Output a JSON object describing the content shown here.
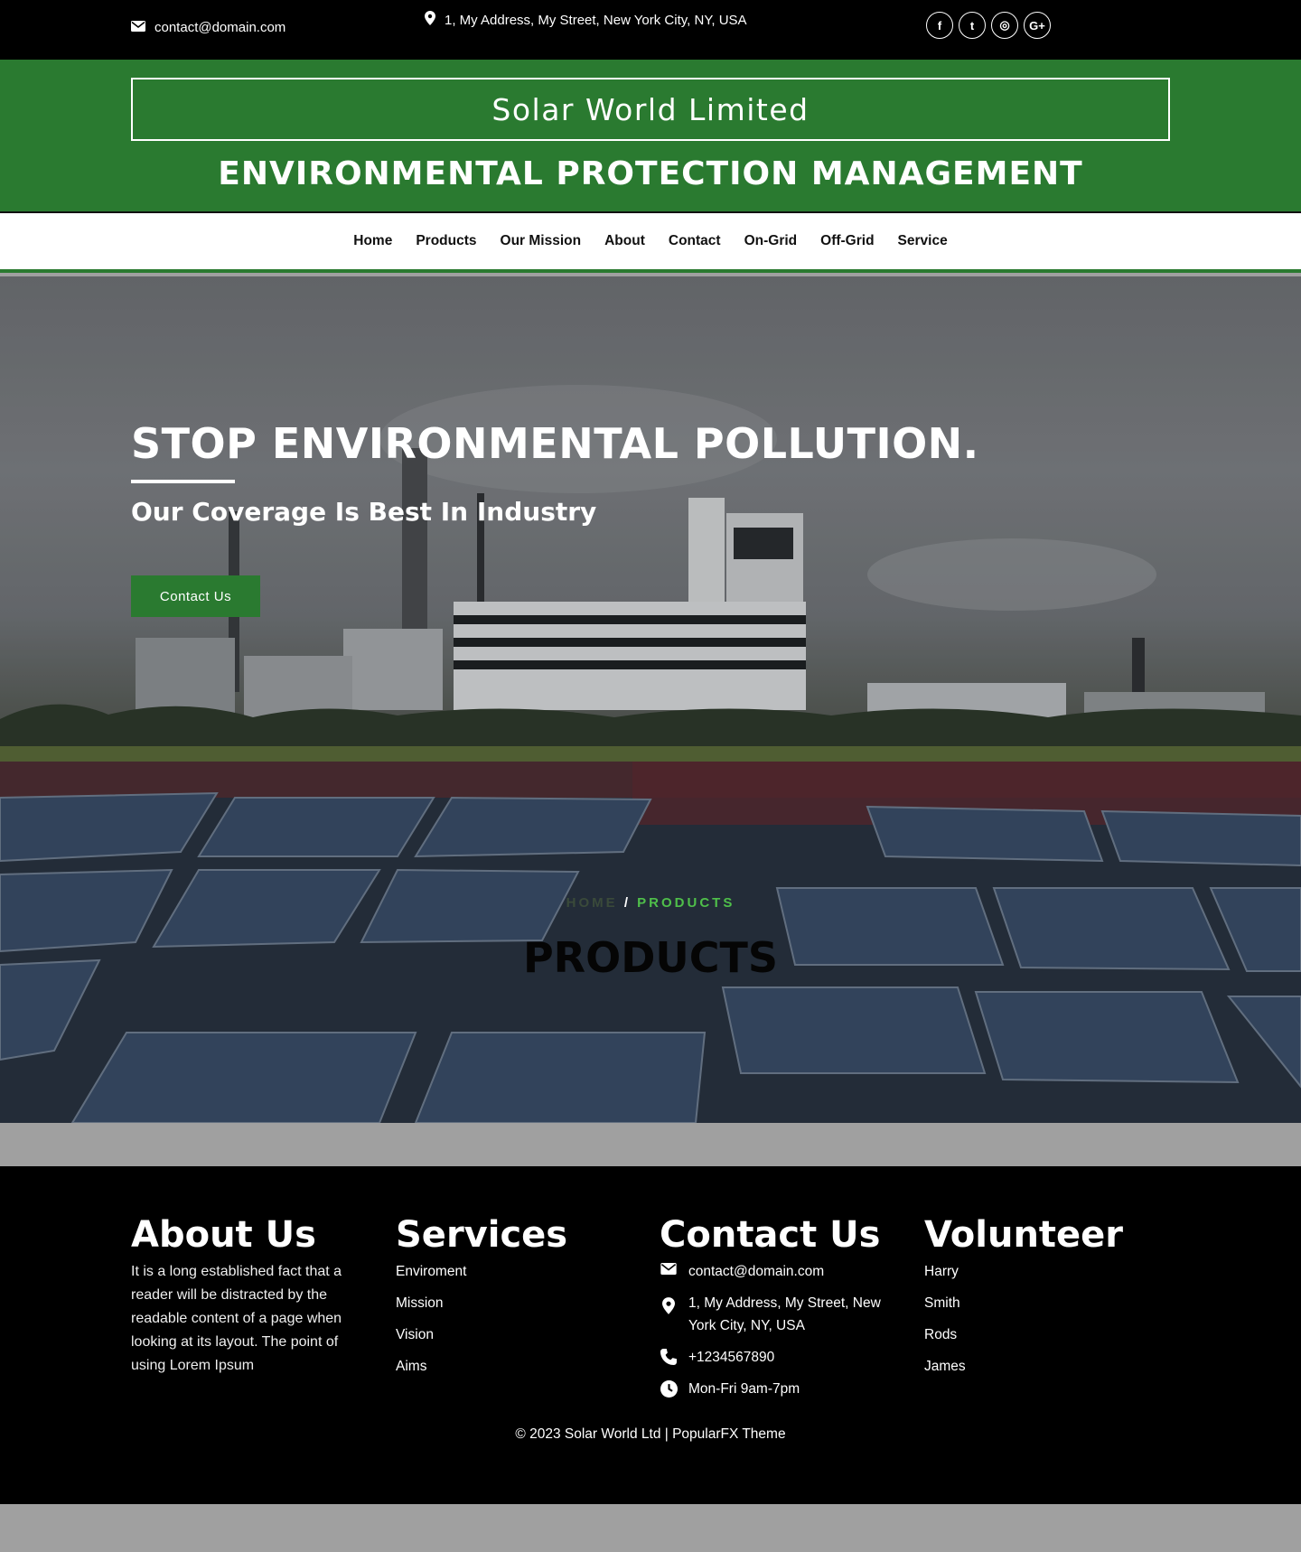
{
  "topbar": {
    "email": "contact@domain.com",
    "address": "1, My Address, My Street, New York City, NY, USA",
    "social": [
      {
        "icon": "facebook-icon",
        "glyph": "f"
      },
      {
        "icon": "twitter-icon",
        "glyph": "t"
      },
      {
        "icon": "instagram-icon",
        "glyph": "◎"
      },
      {
        "icon": "google-plus-icon",
        "glyph": "G+"
      }
    ]
  },
  "header": {
    "brand": "Solar World Limited",
    "tagline": "ENVIRONMENTAL PROTECTION MANAGEMENT"
  },
  "nav": {
    "items": [
      "Home",
      "Products",
      "Our Mission",
      "About",
      "Contact",
      "On-Grid",
      "Off-Grid",
      "Service"
    ]
  },
  "hero": {
    "title": "STOP ENVIRONMENTAL POLLUTION.",
    "subtitle": "Our Coverage Is Best In Industry",
    "button": "Contact Us"
  },
  "banner": {
    "breadcrumb_home": "HOME",
    "breadcrumb_sep": "/",
    "breadcrumb_current": "PRODUCTS",
    "title": "PRODUCTS"
  },
  "footer": {
    "about": {
      "heading": "About Us",
      "text": "It is a long established fact that a reader will be distracted by the readable content of a page when looking at its layout. The point of using Lorem Ipsum"
    },
    "services": {
      "heading": "Services",
      "items": [
        "Enviroment",
        "Mission",
        "Vision",
        "Aims"
      ]
    },
    "contact": {
      "heading": "Contact Us",
      "email": "contact@domain.com",
      "address": "1, My Address, My Street, New York City, NY, USA",
      "phone": "+1234567890",
      "hours": "Mon-Fri 9am-7pm"
    },
    "volunteer": {
      "heading": "Volunteer",
      "items": [
        "Harry",
        "Smith",
        "Rods",
        "James"
      ]
    },
    "copyright": "© 2023 Solar World Ltd | PopularFX Theme"
  },
  "colors": {
    "brand_green": "#2a7a30",
    "breadcrumb_active": "#4fbf4a",
    "topbar_bg": "#000000"
  }
}
